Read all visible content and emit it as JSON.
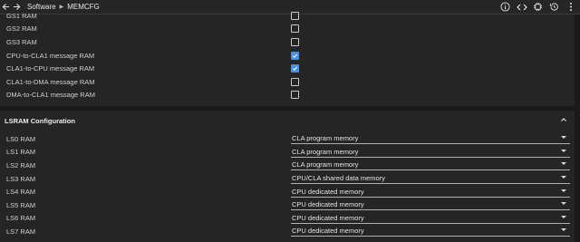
{
  "breadcrumb": {
    "root": "Software",
    "current": "MEMCFG"
  },
  "toolbar_icons": [
    "info-icon",
    "code-icon",
    "chip-icon",
    "history-icon",
    "more-vert-icon"
  ],
  "ram_rows": [
    {
      "label": "GS1 RAM",
      "checked": false
    },
    {
      "label": "GS2 RAM",
      "checked": false
    },
    {
      "label": "GS3 RAM",
      "checked": false
    },
    {
      "label": "CPU-to-CLA1 message RAM",
      "checked": true
    },
    {
      "label": "CLA1-to-CPU message RAM",
      "checked": true
    },
    {
      "label": "CLA1-to-DMA message RAM",
      "checked": false
    },
    {
      "label": "DMA-to-CLA1 message RAM",
      "checked": false
    }
  ],
  "lsram": {
    "title": "LSRAM Configuration",
    "rows": [
      {
        "label": "LS0 RAM",
        "value": "CLA program memory"
      },
      {
        "label": "LS1 RAM",
        "value": "CLA program memory"
      },
      {
        "label": "LS2 RAM",
        "value": "CLA program memory"
      },
      {
        "label": "LS3 RAM",
        "value": "CPU/CLA shared data memory"
      },
      {
        "label": "LS4 RAM",
        "value": "CPU dedicated memory"
      },
      {
        "label": "LS5 RAM",
        "value": "CPU dedicated memory"
      },
      {
        "label": "LS6 RAM",
        "value": "CPU dedicated memory"
      },
      {
        "label": "LS7 RAM",
        "value": "CPU dedicated memory"
      }
    ]
  },
  "colors": {
    "background": "#1e1e1e",
    "panel": "#252526",
    "accent": "#4a90e2"
  }
}
